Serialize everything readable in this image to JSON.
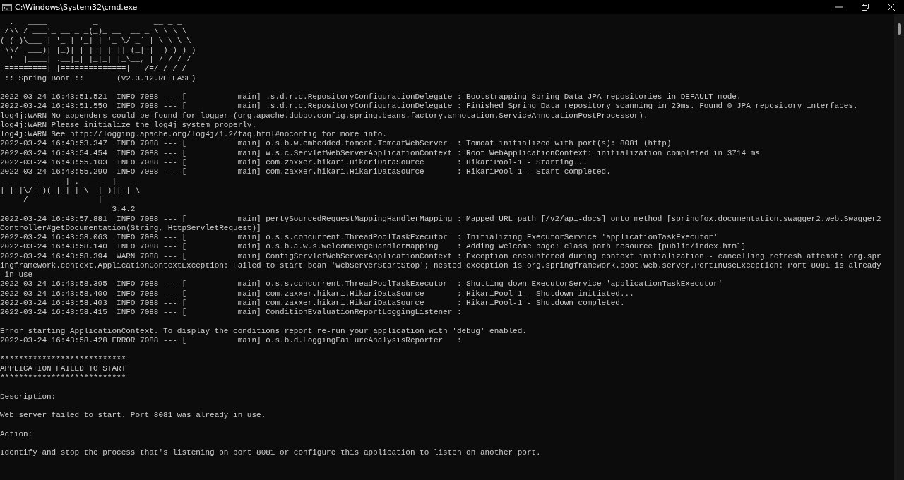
{
  "window": {
    "title": "C:\\Windows\\System32\\cmd.exe"
  },
  "console": {
    "lines": [
      {
        "kind": "text",
        "text": "  .   ____          _            __ _ _"
      },
      {
        "kind": "text",
        "text": " /\\\\ / ___'_ __ _ _(_)_ __  __ _ \\ \\ \\ \\"
      },
      {
        "kind": "text",
        "text": "( ( )\\___ | '_ | '_| | '_ \\/ _` | \\ \\ \\ \\"
      },
      {
        "kind": "text",
        "text": " \\\\/  ___)| |_)| | | | | || (_| |  ) ) ) )"
      },
      {
        "kind": "text",
        "text": "  '  |____| .__|_| |_|_| |_\\__, | / / / /"
      },
      {
        "kind": "text",
        "text": " =========|_|==============|___/=/_/_/_/"
      },
      {
        "kind": "text",
        "text": " :: Spring Boot ::       (v2.3.12.RELEASE)"
      },
      {
        "kind": "blank"
      },
      {
        "kind": "text",
        "text": "2022-03-24 16:43:51.521  INFO 7088 --- [           main] .s.d.r.c.RepositoryConfigurationDelegate : Bootstrapping Spring Data JPA repositories in DEFAULT mode."
      },
      {
        "kind": "text",
        "text": "2022-03-24 16:43:51.550  INFO 7088 --- [           main] .s.d.r.c.RepositoryConfigurationDelegate : Finished Spring Data repository scanning in 20ms. Found 0 JPA repository interfaces."
      },
      {
        "kind": "text",
        "text": "log4j:WARN No appenders could be found for logger (org.apache.dubbo.config.spring.beans.factory.annotation.ServiceAnnotationPostProcessor)."
      },
      {
        "kind": "text",
        "text": "log4j:WARN Please initialize the log4j system properly."
      },
      {
        "kind": "text",
        "text": "log4j:WARN See http://logging.apache.org/log4j/1.2/faq.html#noconfig for more info."
      },
      {
        "kind": "text",
        "text": "2022-03-24 16:43:53.347  INFO 7088 --- [           main] o.s.b.w.embedded.tomcat.TomcatWebServer  : Tomcat initialized with port(s): 8081 (http)"
      },
      {
        "kind": "text",
        "text": "2022-03-24 16:43:54.454  INFO 7088 --- [           main] w.s.c.ServletWebServerApplicationContext : Root WebApplicationContext: initialization completed in 3714 ms"
      },
      {
        "kind": "text",
        "text": "2022-03-24 16:43:55.103  INFO 7088 --- [           main] com.zaxxer.hikari.HikariDataSource       : HikariPool-1 - Starting..."
      },
      {
        "kind": "text",
        "text": "2022-03-24 16:43:55.290  INFO 7088 --- [           main] com.zaxxer.hikari.HikariDataSource       : HikariPool-1 - Start completed."
      },
      {
        "kind": "text",
        "text": " _ _   |_  _ _|_. ___ _ |    _"
      },
      {
        "kind": "text",
        "text": "| | |\\/|_)(_| | |_\\  |_)||_|_\\"
      },
      {
        "kind": "text",
        "text": "     /               |"
      },
      {
        "kind": "text",
        "text": "                        3.4.2"
      },
      {
        "kind": "text",
        "text": "2022-03-24 16:43:57.881  INFO 7088 --- [           main] pertySourcedRequestMappingHandlerMapping : Mapped URL path [/v2/api-docs] onto method [springfox.documentation.swagger2.web.Swagger2"
      },
      {
        "kind": "text",
        "text": "Controller#getDocumentation(String, HttpServletRequest)]"
      },
      {
        "kind": "text",
        "text": "2022-03-24 16:43:58.063  INFO 7088 --- [           main] o.s.s.concurrent.ThreadPoolTaskExecutor  : Initializing ExecutorService 'applicationTaskExecutor'"
      },
      {
        "kind": "text",
        "text": "2022-03-24 16:43:58.140  INFO 7088 --- [           main] o.s.b.a.w.s.WelcomePageHandlerMapping    : Adding welcome page: class path resource [public/index.html]"
      },
      {
        "kind": "text",
        "text": "2022-03-24 16:43:58.394  WARN 7088 --- [           main] ConfigServletWebServerApplicationContext : Exception encountered during context initialization - cancelling refresh attempt: org.spr"
      },
      {
        "kind": "text",
        "text": "ingframework.context.ApplicationContextException: Failed to start bean 'webServerStartStop'; nested exception is org.springframework.boot.web.server.PortInUseException: Port 8081 is already"
      },
      {
        "kind": "text",
        "text": " in use"
      },
      {
        "kind": "text",
        "text": "2022-03-24 16:43:58.395  INFO 7088 --- [           main] o.s.s.concurrent.ThreadPoolTaskExecutor  : Shutting down ExecutorService 'applicationTaskExecutor'"
      },
      {
        "kind": "text",
        "text": "2022-03-24 16:43:58.400  INFO 7088 --- [           main] com.zaxxer.hikari.HikariDataSource       : HikariPool-1 - Shutdown initiated..."
      },
      {
        "kind": "text",
        "text": "2022-03-24 16:43:58.403  INFO 7088 --- [           main] com.zaxxer.hikari.HikariDataSource       : HikariPool-1 - Shutdown completed."
      },
      {
        "kind": "text",
        "text": "2022-03-24 16:43:58.415  INFO 7088 --- [           main] ConditionEvaluationReportLoggingListener :"
      },
      {
        "kind": "blank"
      },
      {
        "kind": "text",
        "text": "Error starting ApplicationContext. To display the conditions report re-run your application with 'debug' enabled."
      },
      {
        "kind": "text",
        "text": "2022-03-24 16:43:58.428 ERROR 7088 --- [           main] o.s.b.d.LoggingFailureAnalysisReporter   :"
      },
      {
        "kind": "blank"
      },
      {
        "kind": "text",
        "text": "***************************"
      },
      {
        "kind": "text",
        "text": "APPLICATION FAILED TO START"
      },
      {
        "kind": "text",
        "text": "***************************"
      },
      {
        "kind": "blank"
      },
      {
        "kind": "text",
        "text": "Description:"
      },
      {
        "kind": "blank"
      },
      {
        "kind": "text",
        "text": "Web server failed to start. Port 8081 was already in use."
      },
      {
        "kind": "blank"
      },
      {
        "kind": "text",
        "text": "Action:"
      },
      {
        "kind": "blank"
      },
      {
        "kind": "text",
        "text": "Identify and stop the process that's listening on port 8081 or configure this application to listen on another port."
      }
    ]
  }
}
